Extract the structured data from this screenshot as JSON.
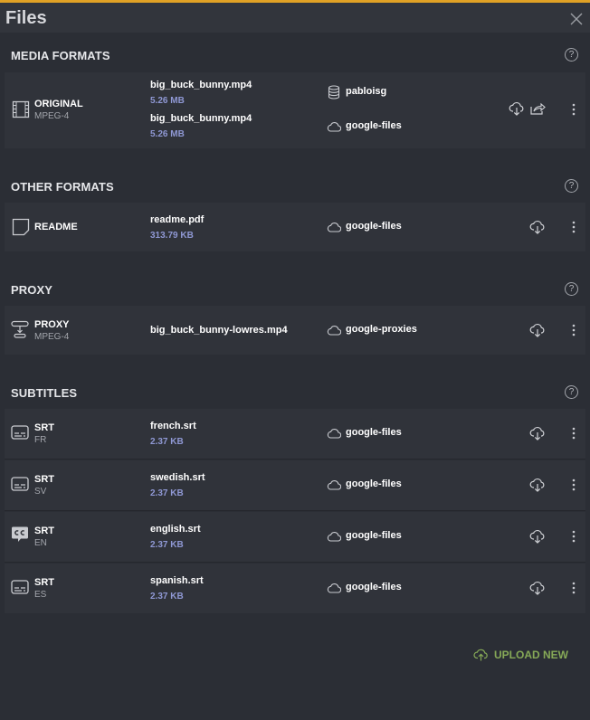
{
  "window": {
    "title": "Files"
  },
  "colors": {
    "accent": "#e0a125",
    "upload": "#86a957",
    "size": "#8f98d4"
  },
  "help_glyph": "?",
  "sections": {
    "media": {
      "title": "MEDIA FORMATS",
      "format": "ORIGINAL",
      "subformat": "MPEG-4",
      "files": [
        {
          "name": "big_buck_bunny.mp4",
          "size": "5.26 MB",
          "storage": "pabloisg",
          "storage_icon": "database-icon"
        },
        {
          "name": "big_buck_bunny.mp4",
          "size": "5.26 MB",
          "storage": "google-files",
          "storage_icon": "cloud-icon"
        }
      ]
    },
    "other": {
      "title": "OTHER FORMATS",
      "format": "README",
      "file": {
        "name": "readme.pdf",
        "size": "313.79 KB",
        "storage": "google-files"
      }
    },
    "proxy": {
      "title": "PROXY",
      "format": "PROXY",
      "subformat": "MPEG-4",
      "file": {
        "name": "big_buck_bunny-lowres.mp4",
        "storage": "google-proxies"
      }
    },
    "subtitles": {
      "title": "SUBTITLES",
      "rows": [
        {
          "format": "SRT",
          "lang": "FR",
          "name": "french.srt",
          "size": "2.37 KB",
          "storage": "google-files",
          "icon": "subtitle-icon"
        },
        {
          "format": "SRT",
          "lang": "SV",
          "name": "swedish.srt",
          "size": "2.37 KB",
          "storage": "google-files",
          "icon": "subtitle-icon"
        },
        {
          "format": "SRT",
          "lang": "EN",
          "name": "english.srt",
          "size": "2.37 KB",
          "storage": "google-files",
          "icon": "closed-caption-icon"
        },
        {
          "format": "SRT",
          "lang": "ES",
          "name": "spanish.srt",
          "size": "2.37 KB",
          "storage": "google-files",
          "icon": "subtitle-icon"
        }
      ]
    }
  },
  "upload": {
    "label": "UPLOAD NEW"
  }
}
